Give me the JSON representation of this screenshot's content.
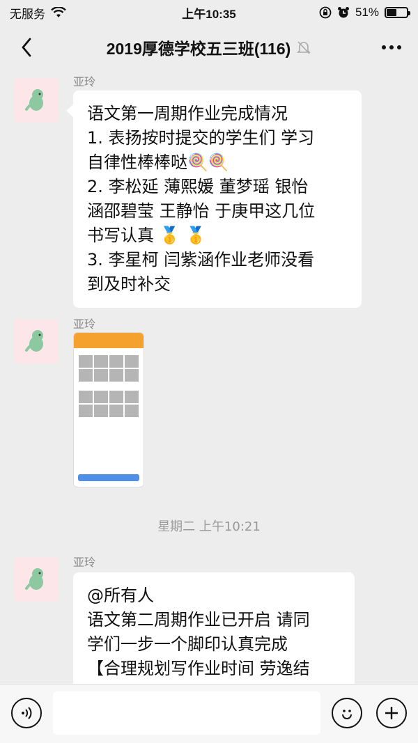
{
  "status": {
    "carrier": "无服务",
    "time": "上午10:35",
    "battery_pct": "51%",
    "battery_level": 0.51
  },
  "nav": {
    "title": "2019厚德学校五三班(116)",
    "icons": [
      "back-icon",
      "mute-bell-icon",
      "more-icon"
    ]
  },
  "messages": [
    {
      "sender": "亚玲",
      "type": "text",
      "lines": [
        "语文第一周期作业完成情况",
        "1. 表扬按时提交的学生们 学习",
        "自律性棒棒哒🍭🍭",
        "2. 李松延 薄熙媛 董梦瑶 银怡",
        "涵邵碧莹 王静怡 于庚甲这几位",
        "书写认真 🥇 🥇",
        "3.  李星柯 闫紫涵作业老师没看",
        "到及时补交"
      ]
    },
    {
      "sender": "亚玲",
      "type": "image"
    },
    {
      "sender": "亚玲",
      "type": "text",
      "lines": [
        "@所有人",
        "语文第二周期作业已开启 请同",
        "学们一步一个脚印认真完成",
        "【合理规划写作业时间 劳逸结"
      ]
    }
  ],
  "timestamp": "星期二 上午10:21",
  "input": {
    "icons": [
      "voice-icon",
      "emoji-icon",
      "plus-icon"
    ]
  },
  "colors": {
    "background": "#ededed",
    "bubble": "#ffffff",
    "avatar_bg": "#fde6ea",
    "image_header": "#f4a12e"
  }
}
